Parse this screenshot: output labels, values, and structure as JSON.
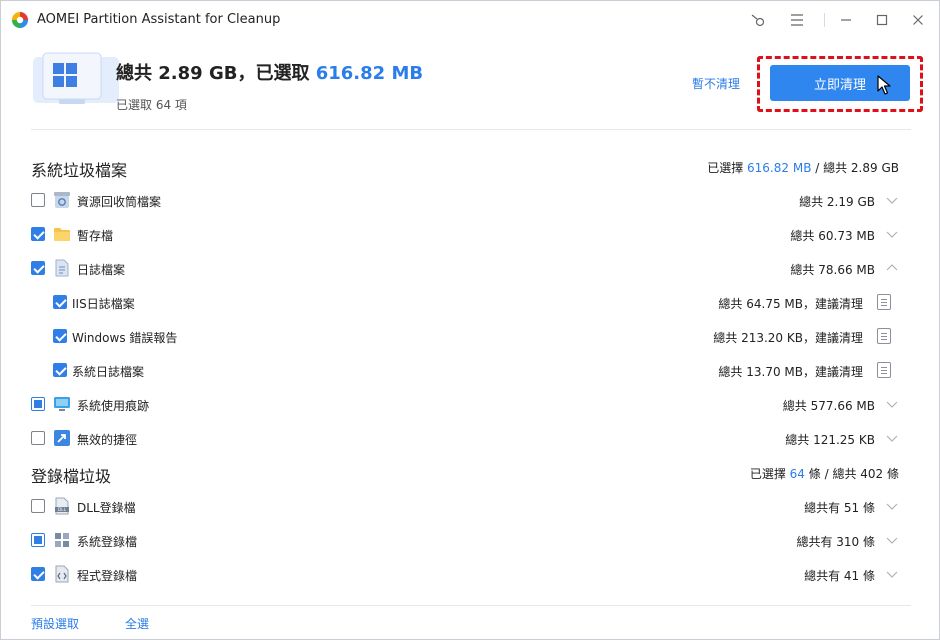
{
  "window": {
    "title": "AOMEI Partition Assistant for Cleanup"
  },
  "summary": {
    "total_prefix": "總共 2.89 GB，已選取",
    "selected_size": "616.82 MB",
    "selected_count": "已選取 64 項",
    "skip_label": "暫不清理",
    "clean_label": "立即清理"
  },
  "sections": {
    "system": {
      "title": "系統垃圾檔案",
      "meta_prefix": "已選擇",
      "meta_selected": "616.82 MB",
      "meta_suffix": "/ 總共 2.89 GB",
      "items": [
        {
          "label": "資源回收筒檔案",
          "size": "總共 2.19 GB",
          "state": "unchecked",
          "icon": "recycle-bin-icon"
        },
        {
          "label": "暫存檔",
          "size": "總共 60.73 MB",
          "state": "checked",
          "icon": "folder-icon"
        },
        {
          "label": "日誌檔案",
          "size": "總共 78.66 MB",
          "state": "checked",
          "icon": "log-file-icon",
          "children": [
            {
              "label": "IIS日誌檔案",
              "size": "總共 64.75 MB，建議清理",
              "state": "checked"
            },
            {
              "label": "Windows 錯誤報告",
              "size": "總共 213.20 KB，建議清理",
              "state": "checked"
            },
            {
              "label": "系統日誌檔案",
              "size": "總共 13.70 MB，建議清理",
              "state": "checked"
            }
          ]
        },
        {
          "label": "系統使用痕跡",
          "size": "總共 577.66 MB",
          "state": "partial",
          "icon": "monitor-icon"
        },
        {
          "label": "無效的捷徑",
          "size": "總共 121.25 KB",
          "state": "unchecked",
          "icon": "shortcut-icon"
        }
      ]
    },
    "registry": {
      "title": "登錄檔垃圾",
      "meta_prefix": "已選擇",
      "meta_selected": "64",
      "meta_suffix": "條 / 總共 402 條",
      "items": [
        {
          "label": "DLL登錄檔",
          "size": "總共有 51 條",
          "state": "unchecked",
          "icon": "dll-icon"
        },
        {
          "label": "系統登錄檔",
          "size": "總共有 310 條",
          "state": "partial",
          "icon": "registry-grid-icon"
        },
        {
          "label": "程式登錄檔",
          "size": "總共有 41 條",
          "state": "checked",
          "icon": "code-file-icon"
        }
      ]
    }
  },
  "footer": {
    "default_label": "預設選取",
    "all_label": "全選"
  },
  "colors": {
    "accent": "#2f86ef",
    "highlight": "#e0101a"
  }
}
